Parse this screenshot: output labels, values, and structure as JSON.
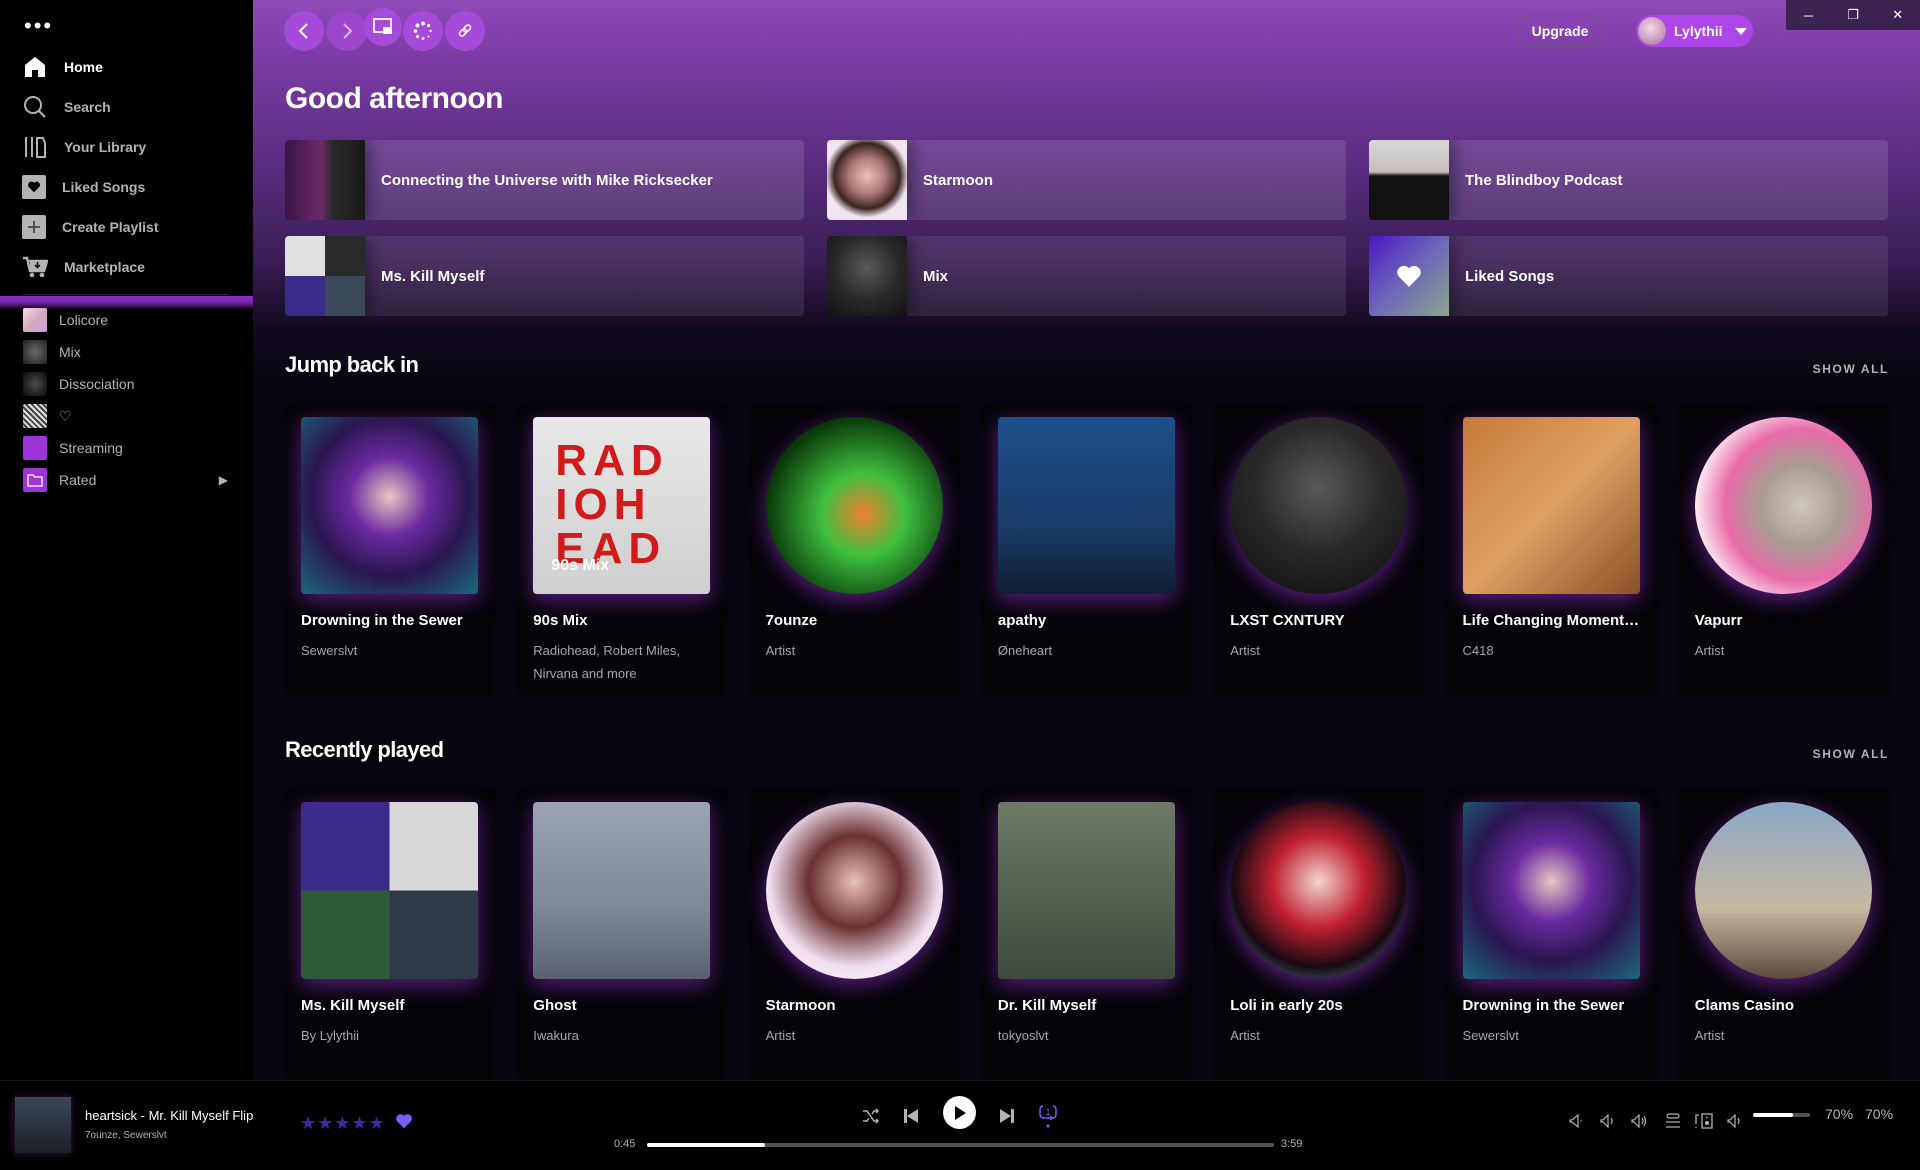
{
  "window": {
    "controls": [
      "minimize",
      "restore",
      "close"
    ]
  },
  "sidebar": {
    "menu_icon": "more-dots-icon",
    "nav": [
      {
        "label": "Home",
        "icon": "home-icon",
        "active": true
      },
      {
        "label": "Search",
        "icon": "search-icon",
        "active": false
      },
      {
        "label": "Your Library",
        "icon": "library-icon",
        "active": false
      },
      {
        "label": "Liked Songs",
        "icon": "heart-icon",
        "active": false
      },
      {
        "label": "Create Playlist",
        "icon": "plus-icon",
        "active": false
      },
      {
        "label": "Marketplace",
        "icon": "cart-icon",
        "active": false
      }
    ],
    "playlists": [
      {
        "label": "Lolicore",
        "thumb": "#e9c9d6"
      },
      {
        "label": "Mix",
        "thumb": "#3a3a3a"
      },
      {
        "label": "Dissociation",
        "thumb": "#1a1a1a"
      },
      {
        "label": "♡",
        "thumb": "#cfcfcf"
      },
      {
        "label": "Streaming",
        "thumb": "#9b35d8"
      },
      {
        "label": "Rated",
        "thumb": "#9b35d8",
        "folder": true
      }
    ]
  },
  "topbar": {
    "nav_buttons": [
      "back",
      "forward",
      "miniplayer",
      "loading",
      "link"
    ],
    "upgrade_label": "Upgrade",
    "user_name": "Lylythii"
  },
  "greeting": "Good afternoon",
  "shortcuts": [
    {
      "title": "Connecting the Universe with Mike Ricksecker"
    },
    {
      "title": "Starmoon"
    },
    {
      "title": "The Blindboy Podcast"
    },
    {
      "title": "Ms. Kill Myself"
    },
    {
      "title": "Mix"
    },
    {
      "title": "Liked Songs"
    }
  ],
  "sections": [
    {
      "title": "Jump back in",
      "show_all": "SHOW ALL",
      "cards": [
        {
          "title": "Drowning in the Sewer",
          "subtitle": "Sewerslvt",
          "round": false
        },
        {
          "title": "90s Mix",
          "subtitle": "Radiohead, Robert Miles, Nirvana and more",
          "round": false,
          "overlay": "90s Mix"
        },
        {
          "title": "7ounze",
          "subtitle": "Artist",
          "round": true
        },
        {
          "title": "apathy",
          "subtitle": "Øneheart",
          "round": false
        },
        {
          "title": "LXST CXNTURY",
          "subtitle": "Artist",
          "round": true
        },
        {
          "title": "Life Changing Moments Seem Minor in Pictures",
          "subtitle": "C418",
          "round": false
        },
        {
          "title": "Vapurr",
          "subtitle": "Artist",
          "round": true
        }
      ]
    },
    {
      "title": "Recently played",
      "show_all": "SHOW ALL",
      "cards": [
        {
          "title": "Ms. Kill Myself",
          "subtitle": "By Lylythii",
          "round": false
        },
        {
          "title": "Ghost",
          "subtitle": "Iwakura",
          "round": false
        },
        {
          "title": "Starmoon",
          "subtitle": "Artist",
          "round": true
        },
        {
          "title": "Dr. Kill Myself",
          "subtitle": "tokyoslvt",
          "round": false
        },
        {
          "title": "Loli in early 20s",
          "subtitle": "Artist",
          "round": true
        },
        {
          "title": "Drowning in the Sewer",
          "subtitle": "Sewerslvt",
          "round": false
        },
        {
          "title": "Clams Casino",
          "subtitle": "Artist",
          "round": true
        }
      ]
    }
  ],
  "player": {
    "track_title": "heartsick - Mr. Kill Myself Flip",
    "track_artists": "7ounze, Sewerslvt",
    "rating_stars": 5,
    "liked": true,
    "elapsed": "0:45",
    "duration": "3:59",
    "progress_fraction": 0.188,
    "repeat_mode": "repeat-one",
    "volume_fraction": 0.7,
    "volume_label_1": "70%",
    "volume_label_2": "70%",
    "accent_color": "#7c5cff"
  }
}
